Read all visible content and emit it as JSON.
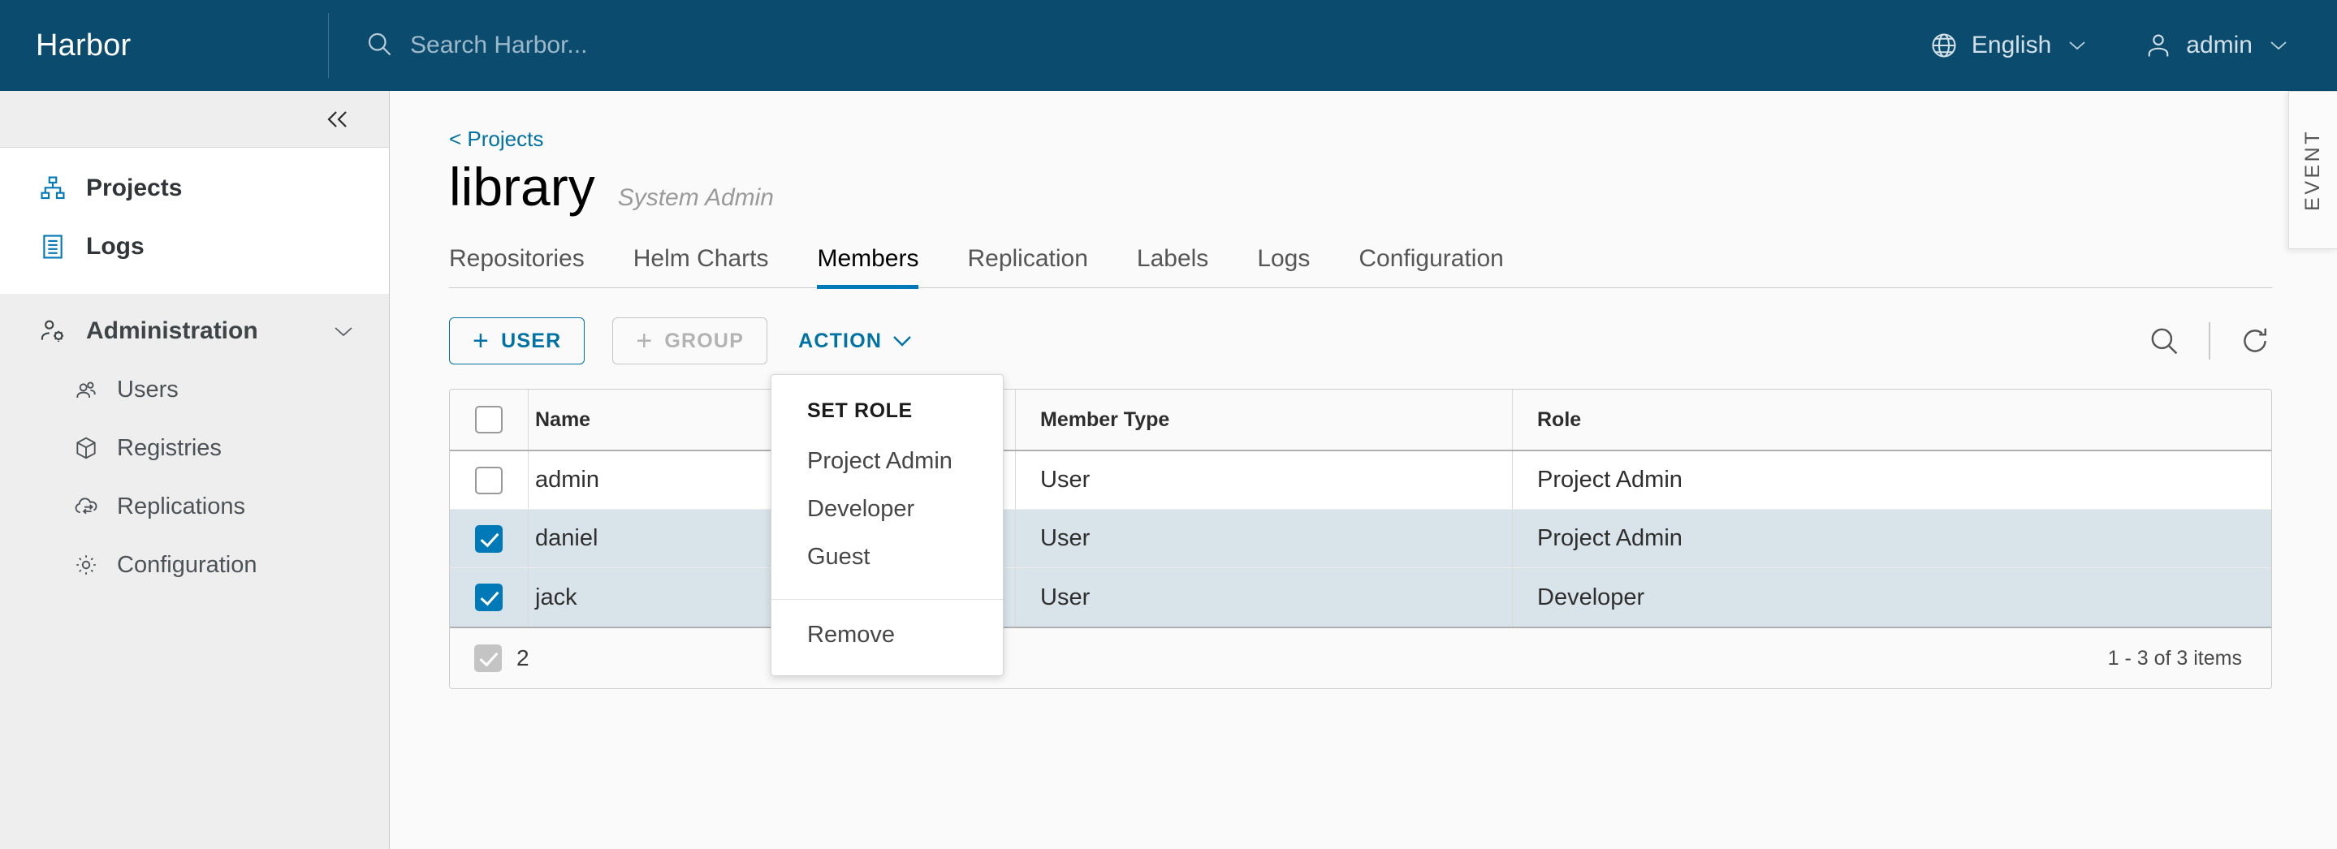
{
  "header": {
    "brand": "Harbor",
    "search_placeholder": "Search Harbor...",
    "search_value": "",
    "language": "English",
    "user": "admin",
    "bg_color": "#0a4b6e"
  },
  "sidebar": {
    "collapse_label": "«",
    "items": [
      {
        "label": "Projects",
        "icon": "projects-icon"
      },
      {
        "label": "Logs",
        "icon": "logs-icon"
      }
    ],
    "section": {
      "label": "Administration",
      "icon": "administration-icon",
      "chevron": "⌄",
      "items": [
        {
          "label": "Users",
          "icon": "users-icon"
        },
        {
          "label": "Registries",
          "icon": "registries-icon"
        },
        {
          "label": "Replications",
          "icon": "replications-icon"
        },
        {
          "label": "Configuration",
          "icon": "configuration-icon"
        }
      ]
    }
  },
  "main": {
    "breadcrumb": "< Projects",
    "title": "library",
    "subtitle": "System Admin",
    "tabs": [
      {
        "label": "Repositories",
        "active": false
      },
      {
        "label": "Helm Charts",
        "active": false
      },
      {
        "label": "Members",
        "active": true
      },
      {
        "label": "Replication",
        "active": false
      },
      {
        "label": "Labels",
        "active": false
      },
      {
        "label": "Logs",
        "active": false
      },
      {
        "label": "Configuration",
        "active": false
      }
    ],
    "toolbar": {
      "user_button": "USER",
      "group_button": "GROUP",
      "action_button": "ACTION",
      "action_caret": "⌄",
      "plus": "+"
    },
    "dropdown": {
      "header": "SET ROLE",
      "items": [
        "Project Admin",
        "Developer",
        "Guest"
      ],
      "remove": "Remove"
    },
    "table": {
      "columns": [
        "Name",
        "Member Type",
        "Role"
      ],
      "rows": [
        {
          "name": "admin",
          "member_type": "User",
          "role": "Project Admin",
          "selected": false
        },
        {
          "name": "daniel",
          "member_type": "User",
          "role": "Project Admin",
          "selected": true
        },
        {
          "name": "jack",
          "member_type": "User",
          "role": "Developer",
          "selected": true
        }
      ],
      "footer": {
        "selected_count": "2",
        "pagination": "1 - 3 of 3 items"
      }
    }
  },
  "event_panel": {
    "label": "EVENT"
  },
  "colors": {
    "accent": "#0079b8",
    "link": "#0072a3",
    "header_bg": "#0a4b6e",
    "selected_row": "#d9e4ea",
    "sidebar_bg": "#eeeeee"
  }
}
